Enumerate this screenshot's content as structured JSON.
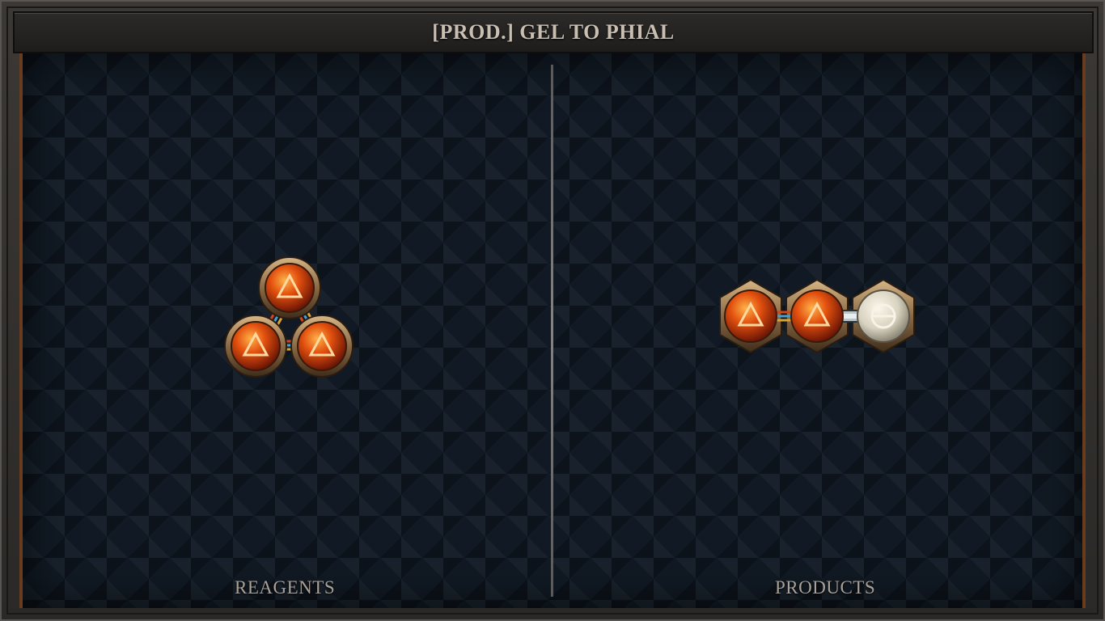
{
  "title": "[PROD.] GEL TO PHIAL",
  "zones": {
    "reagents_label": "REAGENTS",
    "products_label": "PRODUCTS"
  },
  "reagent_molecule": {
    "atoms": [
      {
        "element": "fire",
        "symbol": "fire-triangle-icon"
      },
      {
        "element": "fire",
        "symbol": "fire-triangle-icon"
      },
      {
        "element": "fire",
        "symbol": "fire-triangle-icon"
      }
    ],
    "bonds": [
      "triplex",
      "triplex",
      "triplex"
    ]
  },
  "product_molecule": {
    "atoms": [
      {
        "element": "fire",
        "symbol": "fire-triangle-icon"
      },
      {
        "element": "fire",
        "symbol": "fire-triangle-icon"
      },
      {
        "element": "salt",
        "symbol": "salt-theta-icon"
      }
    ],
    "bonds": [
      "triplex",
      "normal"
    ]
  },
  "colors": {
    "fire_atom": "#e2500e",
    "salt_atom": "#d8d2c0",
    "brass_rim": "#8a6a45",
    "board_bg": "#111a24"
  }
}
